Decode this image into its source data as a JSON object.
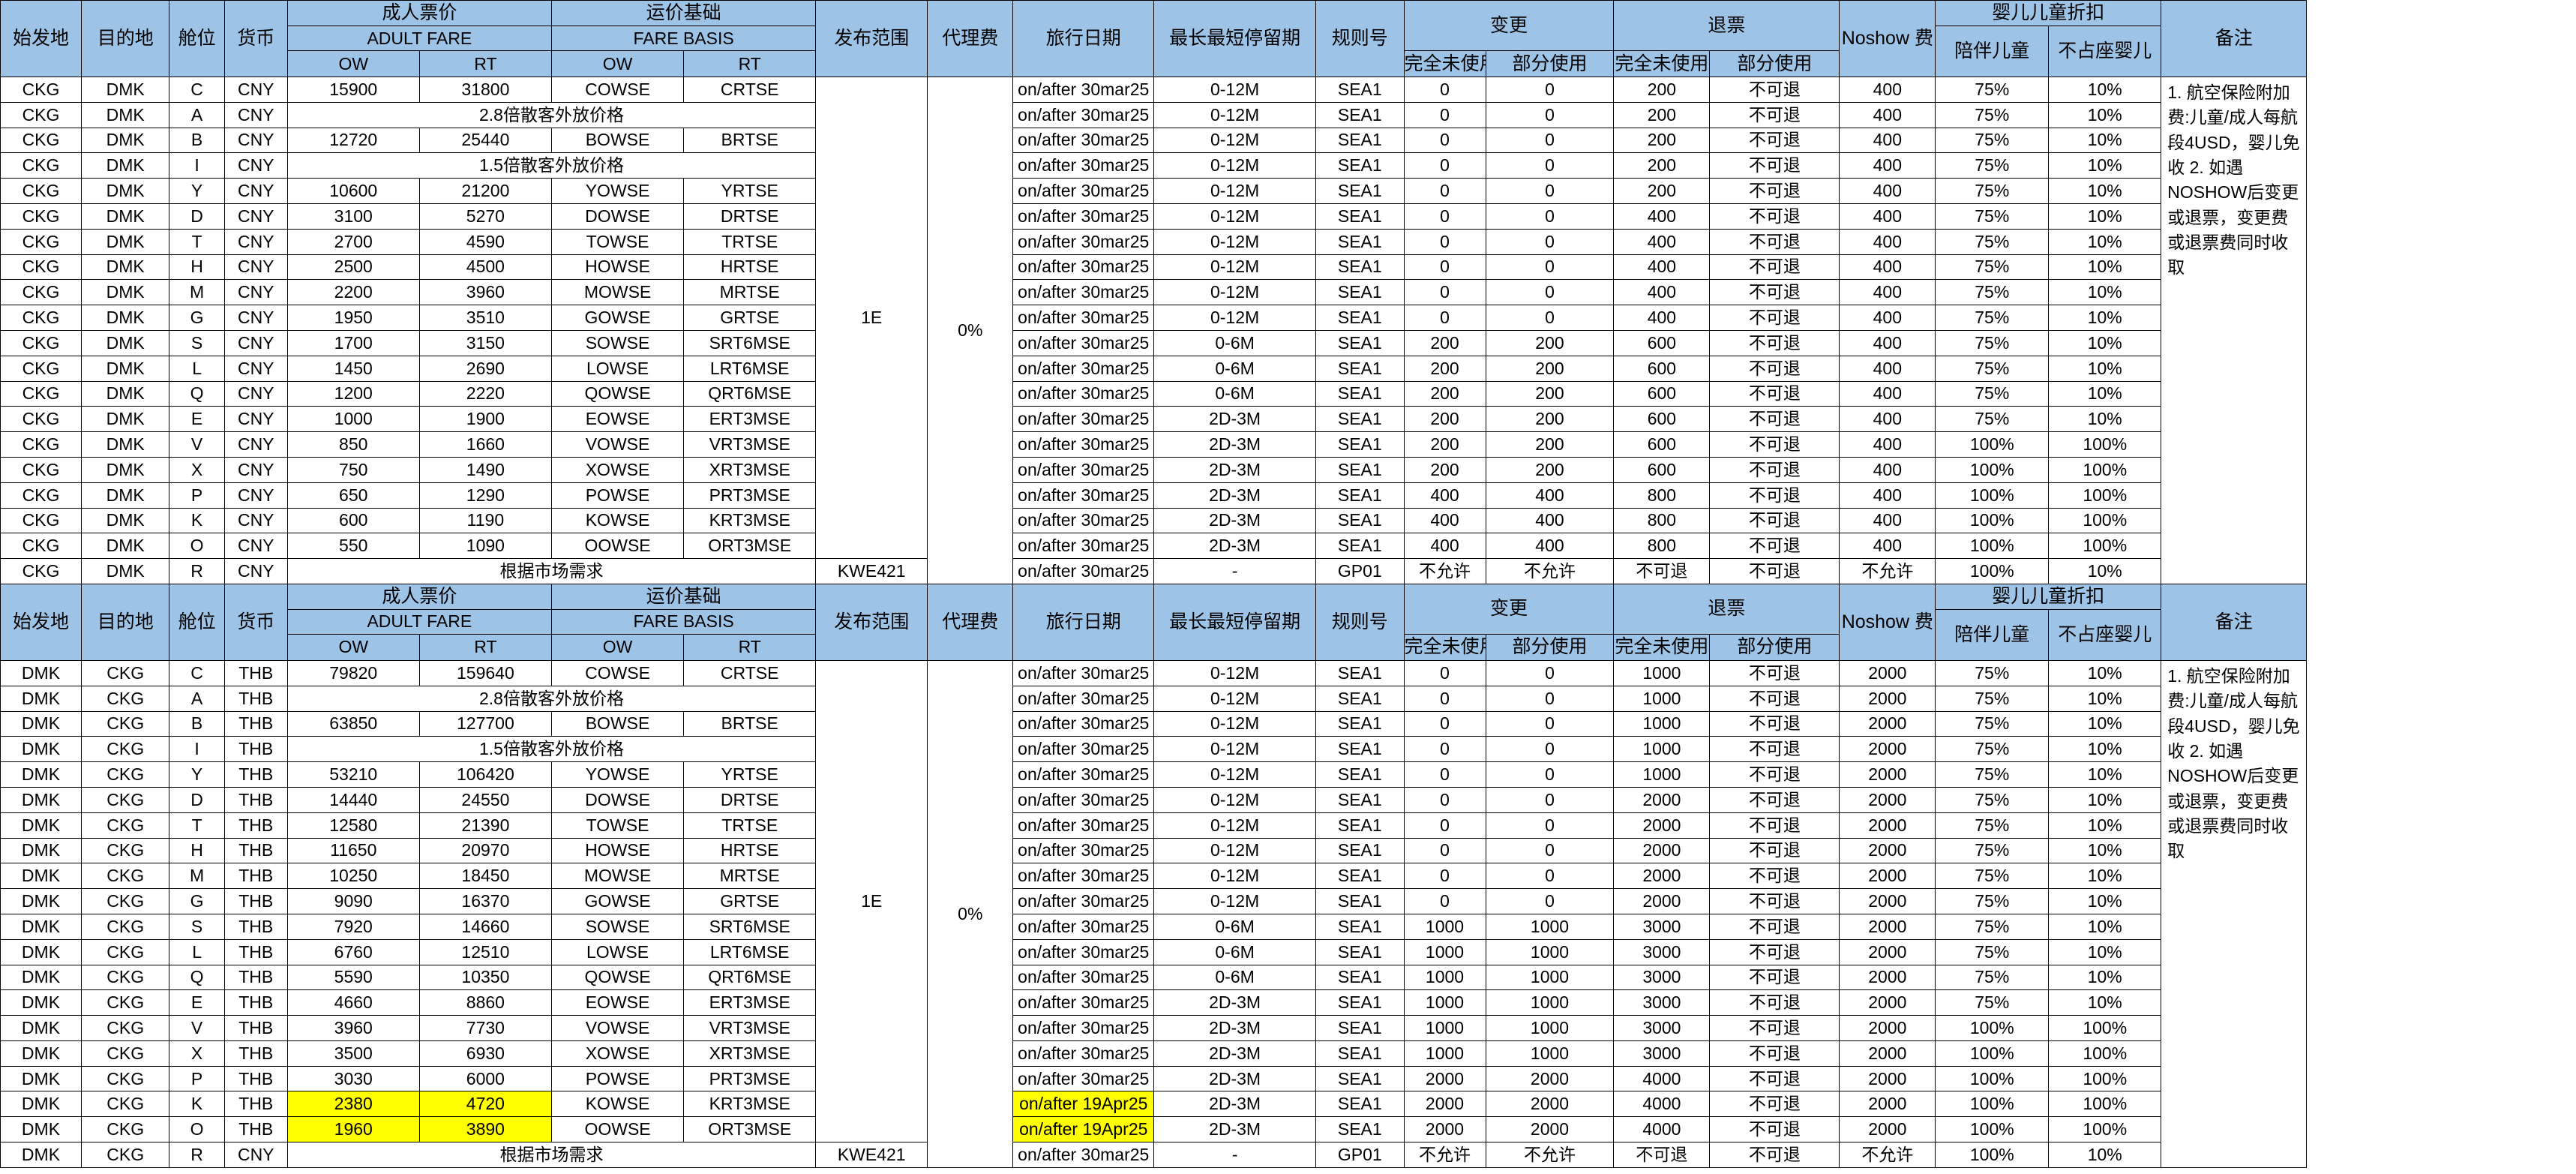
{
  "header": {
    "origin": "始发地",
    "destination": "目的地",
    "cabin": "舱位",
    "currency": "货币",
    "adult_fare_cn": "成人票价",
    "adult_fare_en": "ADULT FARE",
    "fare_basis_cn": "运价基础",
    "fare_basis_en": "FARE BASIS",
    "ow": "OW",
    "rt": "RT",
    "scope": "发布范围",
    "agent_fee": "代理费",
    "travel_date": "旅行日期",
    "stay": "最长最短停留期",
    "rule": "规则号",
    "change": "变更",
    "refund": "退票",
    "unused": "完全未使用",
    "partial": "部分使用",
    "noshow": "Noshow 费",
    "discount": "婴儿儿童折扣",
    "child": "陪伴儿童",
    "infant": "不占座婴儿",
    "remarks": "备注"
  },
  "sections": [
    {
      "scope": "1E",
      "agent_fee": "0%",
      "remarks": "1. 航空保险附加费:儿童/成人每航段4USD，婴儿免收\n2. 如遇NOSHOW后变更或退票，变更费或退票费同时收取",
      "last_scope": "KWE421",
      "rows": [
        [
          "CKG",
          "DMK",
          "C",
          "CNY",
          "15900",
          "31800",
          "COWSE",
          "CRTSE",
          "on/after 30mar25",
          "0-12M",
          "SEA1",
          "0",
          "0",
          "200",
          "不可退",
          "400",
          "75%",
          "10%"
        ],
        [
          "CKG",
          "DMK",
          "A",
          "CNY",
          "2.8倍散客外放价格",
          null,
          null,
          null,
          "on/after 30mar25",
          "0-12M",
          "SEA1",
          "0",
          "0",
          "200",
          "不可退",
          "400",
          "75%",
          "10%"
        ],
        [
          "CKG",
          "DMK",
          "B",
          "CNY",
          "12720",
          "25440",
          "BOWSE",
          "BRTSE",
          "on/after 30mar25",
          "0-12M",
          "SEA1",
          "0",
          "0",
          "200",
          "不可退",
          "400",
          "75%",
          "10%"
        ],
        [
          "CKG",
          "DMK",
          "I",
          "CNY",
          "1.5倍散客外放价格",
          null,
          null,
          null,
          "on/after 30mar25",
          "0-12M",
          "SEA1",
          "0",
          "0",
          "200",
          "不可退",
          "400",
          "75%",
          "10%"
        ],
        [
          "CKG",
          "DMK",
          "Y",
          "CNY",
          "10600",
          "21200",
          "YOWSE",
          "YRTSE",
          "on/after 30mar25",
          "0-12M",
          "SEA1",
          "0",
          "0",
          "200",
          "不可退",
          "400",
          "75%",
          "10%"
        ],
        [
          "CKG",
          "DMK",
          "D",
          "CNY",
          "3100",
          "5270",
          "DOWSE",
          "DRTSE",
          "on/after 30mar25",
          "0-12M",
          "SEA1",
          "0",
          "0",
          "400",
          "不可退",
          "400",
          "75%",
          "10%"
        ],
        [
          "CKG",
          "DMK",
          "T",
          "CNY",
          "2700",
          "4590",
          "TOWSE",
          "TRTSE",
          "on/after 30mar25",
          "0-12M",
          "SEA1",
          "0",
          "0",
          "400",
          "不可退",
          "400",
          "75%",
          "10%"
        ],
        [
          "CKG",
          "DMK",
          "H",
          "CNY",
          "2500",
          "4500",
          "HOWSE",
          "HRTSE",
          "on/after 30mar25",
          "0-12M",
          "SEA1",
          "0",
          "0",
          "400",
          "不可退",
          "400",
          "75%",
          "10%"
        ],
        [
          "CKG",
          "DMK",
          "M",
          "CNY",
          "2200",
          "3960",
          "MOWSE",
          "MRTSE",
          "on/after 30mar25",
          "0-12M",
          "SEA1",
          "0",
          "0",
          "400",
          "不可退",
          "400",
          "75%",
          "10%"
        ],
        [
          "CKG",
          "DMK",
          "G",
          "CNY",
          "1950",
          "3510",
          "GOWSE",
          "GRTSE",
          "on/after 30mar25",
          "0-12M",
          "SEA1",
          "0",
          "0",
          "400",
          "不可退",
          "400",
          "75%",
          "10%"
        ],
        [
          "CKG",
          "DMK",
          "S",
          "CNY",
          "1700",
          "3150",
          "SOWSE",
          "SRT6MSE",
          "on/after 30mar25",
          "0-6M",
          "SEA1",
          "200",
          "200",
          "600",
          "不可退",
          "400",
          "75%",
          "10%"
        ],
        [
          "CKG",
          "DMK",
          "L",
          "CNY",
          "1450",
          "2690",
          "LOWSE",
          "LRT6MSE",
          "on/after 30mar25",
          "0-6M",
          "SEA1",
          "200",
          "200",
          "600",
          "不可退",
          "400",
          "75%",
          "10%"
        ],
        [
          "CKG",
          "DMK",
          "Q",
          "CNY",
          "1200",
          "2220",
          "QOWSE",
          "QRT6MSE",
          "on/after 30mar25",
          "0-6M",
          "SEA1",
          "200",
          "200",
          "600",
          "不可退",
          "400",
          "75%",
          "10%"
        ],
        [
          "CKG",
          "DMK",
          "E",
          "CNY",
          "1000",
          "1900",
          "EOWSE",
          "ERT3MSE",
          "on/after 30mar25",
          "2D-3M",
          "SEA1",
          "200",
          "200",
          "600",
          "不可退",
          "400",
          "75%",
          "10%"
        ],
        [
          "CKG",
          "DMK",
          "V",
          "CNY",
          "850",
          "1660",
          "VOWSE",
          "VRT3MSE",
          "on/after 30mar25",
          "2D-3M",
          "SEA1",
          "200",
          "200",
          "600",
          "不可退",
          "400",
          "100%",
          "100%"
        ],
        [
          "CKG",
          "DMK",
          "X",
          "CNY",
          "750",
          "1490",
          "XOWSE",
          "XRT3MSE",
          "on/after 30mar25",
          "2D-3M",
          "SEA1",
          "200",
          "200",
          "600",
          "不可退",
          "400",
          "100%",
          "100%"
        ],
        [
          "CKG",
          "DMK",
          "P",
          "CNY",
          "650",
          "1290",
          "POWSE",
          "PRT3MSE",
          "on/after 30mar25",
          "2D-3M",
          "SEA1",
          "400",
          "400",
          "800",
          "不可退",
          "400",
          "100%",
          "100%"
        ],
        [
          "CKG",
          "DMK",
          "K",
          "CNY",
          "600",
          "1190",
          "KOWSE",
          "KRT3MSE",
          "on/after 30mar25",
          "2D-3M",
          "SEA1",
          "400",
          "400",
          "800",
          "不可退",
          "400",
          "100%",
          "100%"
        ],
        [
          "CKG",
          "DMK",
          "O",
          "CNY",
          "550",
          "1090",
          "OOWSE",
          "ORT3MSE",
          "on/after 30mar25",
          "2D-3M",
          "SEA1",
          "400",
          "400",
          "800",
          "不可退",
          "400",
          "100%",
          "100%"
        ],
        [
          "CKG",
          "DMK",
          "R",
          "CNY",
          "根据市场需求",
          null,
          null,
          null,
          "on/after 30mar25",
          "-",
          "GP01",
          "不允许",
          "不允许",
          "不可退",
          "不可退",
          "不允许",
          "100%",
          "10%"
        ]
      ]
    },
    {
      "scope": "1E",
      "agent_fee": "0%",
      "remarks": "1. 航空保险附加费:儿童/成人每航段4USD，婴儿免收\n2. 如遇NOSHOW后变更或退票，变更费或退票费同时收取",
      "last_scope": "KWE421",
      "rows": [
        [
          "DMK",
          "CKG",
          "C",
          "THB",
          "79820",
          "159640",
          "COWSE",
          "CRTSE",
          "on/after 30mar25",
          "0-12M",
          "SEA1",
          "0",
          "0",
          "1000",
          "不可退",
          "2000",
          "75%",
          "10%"
        ],
        [
          "DMK",
          "CKG",
          "A",
          "THB",
          "2.8倍散客外放价格",
          null,
          null,
          null,
          "on/after 30mar25",
          "0-12M",
          "SEA1",
          "0",
          "0",
          "1000",
          "不可退",
          "2000",
          "75%",
          "10%"
        ],
        [
          "DMK",
          "CKG",
          "B",
          "THB",
          "63850",
          "127700",
          "BOWSE",
          "BRTSE",
          "on/after 30mar25",
          "0-12M",
          "SEA1",
          "0",
          "0",
          "1000",
          "不可退",
          "2000",
          "75%",
          "10%"
        ],
        [
          "DMK",
          "CKG",
          "I",
          "THB",
          "1.5倍散客外放价格",
          null,
          null,
          null,
          "on/after 30mar25",
          "0-12M",
          "SEA1",
          "0",
          "0",
          "1000",
          "不可退",
          "2000",
          "75%",
          "10%"
        ],
        [
          "DMK",
          "CKG",
          "Y",
          "THB",
          "53210",
          "106420",
          "YOWSE",
          "YRTSE",
          "on/after 30mar25",
          "0-12M",
          "SEA1",
          "0",
          "0",
          "1000",
          "不可退",
          "2000",
          "75%",
          "10%"
        ],
        [
          "DMK",
          "CKG",
          "D",
          "THB",
          "14440",
          "24550",
          "DOWSE",
          "DRTSE",
          "on/after 30mar25",
          "0-12M",
          "SEA1",
          "0",
          "0",
          "2000",
          "不可退",
          "2000",
          "75%",
          "10%"
        ],
        [
          "DMK",
          "CKG",
          "T",
          "THB",
          "12580",
          "21390",
          "TOWSE",
          "TRTSE",
          "on/after 30mar25",
          "0-12M",
          "SEA1",
          "0",
          "0",
          "2000",
          "不可退",
          "2000",
          "75%",
          "10%"
        ],
        [
          "DMK",
          "CKG",
          "H",
          "THB",
          "11650",
          "20970",
          "HOWSE",
          "HRTSE",
          "on/after 30mar25",
          "0-12M",
          "SEA1",
          "0",
          "0",
          "2000",
          "不可退",
          "2000",
          "75%",
          "10%"
        ],
        [
          "DMK",
          "CKG",
          "M",
          "THB",
          "10250",
          "18450",
          "MOWSE",
          "MRTSE",
          "on/after 30mar25",
          "0-12M",
          "SEA1",
          "0",
          "0",
          "2000",
          "不可退",
          "2000",
          "75%",
          "10%"
        ],
        [
          "DMK",
          "CKG",
          "G",
          "THB",
          "9090",
          "16370",
          "GOWSE",
          "GRTSE",
          "on/after 30mar25",
          "0-12M",
          "SEA1",
          "0",
          "0",
          "2000",
          "不可退",
          "2000",
          "75%",
          "10%"
        ],
        [
          "DMK",
          "CKG",
          "S",
          "THB",
          "7920",
          "14660",
          "SOWSE",
          "SRT6MSE",
          "on/after 30mar25",
          "0-6M",
          "SEA1",
          "1000",
          "1000",
          "3000",
          "不可退",
          "2000",
          "75%",
          "10%"
        ],
        [
          "DMK",
          "CKG",
          "L",
          "THB",
          "6760",
          "12510",
          "LOWSE",
          "LRT6MSE",
          "on/after 30mar25",
          "0-6M",
          "SEA1",
          "1000",
          "1000",
          "3000",
          "不可退",
          "2000",
          "75%",
          "10%"
        ],
        [
          "DMK",
          "CKG",
          "Q",
          "THB",
          "5590",
          "10350",
          "QOWSE",
          "QRT6MSE",
          "on/after 30mar25",
          "0-6M",
          "SEA1",
          "1000",
          "1000",
          "3000",
          "不可退",
          "2000",
          "75%",
          "10%"
        ],
        [
          "DMK",
          "CKG",
          "E",
          "THB",
          "4660",
          "8860",
          "EOWSE",
          "ERT3MSE",
          "on/after 30mar25",
          "2D-3M",
          "SEA1",
          "1000",
          "1000",
          "3000",
          "不可退",
          "2000",
          "75%",
          "10%"
        ],
        [
          "DMK",
          "CKG",
          "V",
          "THB",
          "3960",
          "7730",
          "VOWSE",
          "VRT3MSE",
          "on/after 30mar25",
          "2D-3M",
          "SEA1",
          "1000",
          "1000",
          "3000",
          "不可退",
          "2000",
          "100%",
          "100%"
        ],
        [
          "DMK",
          "CKG",
          "X",
          "THB",
          "3500",
          "6930",
          "XOWSE",
          "XRT3MSE",
          "on/after 30mar25",
          "2D-3M",
          "SEA1",
          "1000",
          "1000",
          "3000",
          "不可退",
          "2000",
          "100%",
          "100%"
        ],
        [
          "DMK",
          "CKG",
          "P",
          "THB",
          "3030",
          "6000",
          "POWSE",
          "PRT3MSE",
          "on/after 30mar25",
          "2D-3M",
          "SEA1",
          "2000",
          "2000",
          "4000",
          "不可退",
          "2000",
          "100%",
          "100%"
        ],
        [
          "DMK",
          "CKG",
          "K",
          "THB",
          "2380",
          "4720",
          "KOWSE",
          "KRT3MSE",
          "on/after 19Apr25",
          "2D-3M",
          "SEA1",
          "2000",
          "2000",
          "4000",
          "不可退",
          "2000",
          "100%",
          "100%"
        ],
        [
          "DMK",
          "CKG",
          "O",
          "THB",
          "1960",
          "3890",
          "OOWSE",
          "ORT3MSE",
          "on/after 19Apr25",
          "2D-3M",
          "SEA1",
          "2000",
          "2000",
          "4000",
          "不可退",
          "2000",
          "100%",
          "100%"
        ],
        [
          "DMK",
          "CKG",
          "R",
          "CNY",
          "根据市场需求",
          null,
          null,
          null,
          "on/after 30mar25",
          "-",
          "GP01",
          "不允许",
          "不允许",
          "不可退",
          "不可退",
          "不允许",
          "100%",
          "10%"
        ]
      ],
      "highlight_rows": [
        17,
        18
      ],
      "highlight_color": "#ffff00"
    }
  ],
  "colors": {
    "header_bg": "#9dc3e6",
    "highlight": "#ffff00",
    "border": "#000000"
  }
}
